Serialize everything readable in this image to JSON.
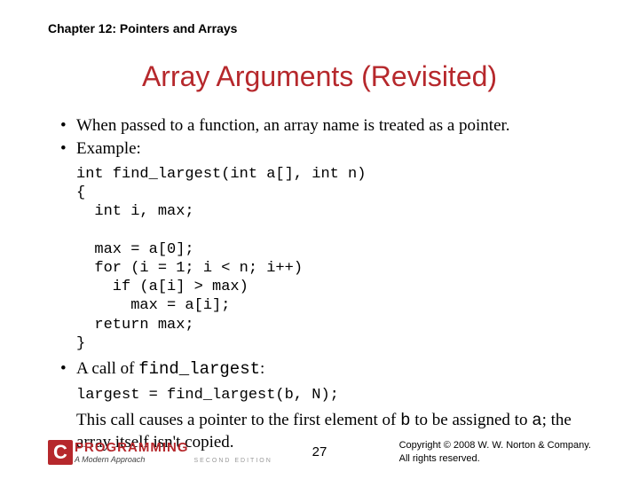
{
  "chapter": "Chapter 12: Pointers and Arrays",
  "title": "Array Arguments (Revisited)",
  "bullets": {
    "b1": "When passed to a function, an array name is treated as a pointer.",
    "b2": "Example:",
    "b3_pre": "A call of ",
    "b3_code": "find_largest",
    "b3_post": ":"
  },
  "code1": "int find_largest(int a[], int n)\n{\n  int i, max;\n\n  max = a[0];\n  for (i = 1; i < n; i++)\n    if (a[i] > max)\n      max = a[i];\n  return max;\n}",
  "code2": "largest = find_largest(b, N);",
  "explain": {
    "t1": "This call causes a pointer to the first element of ",
    "c1": "b",
    "t2": " to be assigned to ",
    "c2": "a",
    "t3": "; the array itself isn't copied."
  },
  "footer": {
    "logo_c": "C",
    "logo_main": "PROGRAMMING",
    "logo_sub": "A Modern Approach",
    "logo_ed": "SECOND EDITION",
    "pagenum": "27",
    "copyright1": "Copyright © 2008 W. W. Norton & Company.",
    "copyright2": "All rights reserved."
  }
}
